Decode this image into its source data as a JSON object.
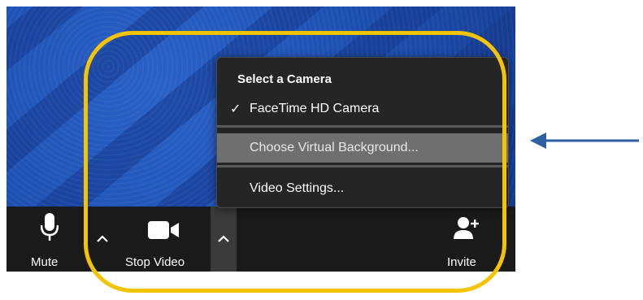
{
  "toolbar": {
    "mute_label": "Mute",
    "stop_video_label": "Stop Video",
    "invite_label": "Invite",
    "icons": {
      "mute": "microphone-icon",
      "audio_options": "caret-up-icon",
      "stop_video": "video-camera-icon",
      "video_options": "caret-up-icon",
      "invite": "add-person-icon"
    }
  },
  "camera_menu": {
    "heading": "Select a Camera",
    "items": [
      {
        "label": "FaceTime HD Camera",
        "checked": true
      },
      {
        "label": "Choose Virtual Background...",
        "highlighted": true
      },
      {
        "label": "Video Settings..."
      }
    ]
  },
  "annotations": {
    "highlight_color": "#f5c400",
    "arrow_color": "#2e5fa0"
  }
}
